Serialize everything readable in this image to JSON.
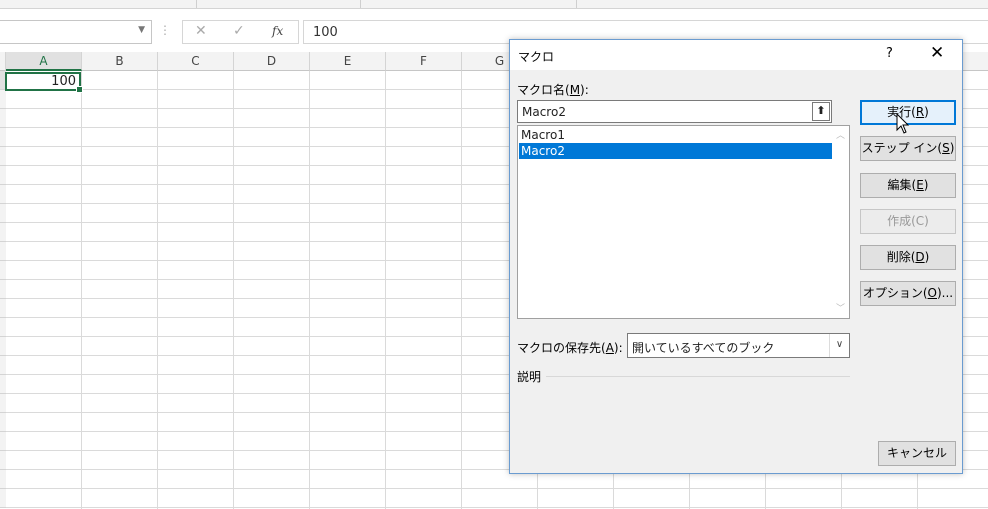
{
  "formula_bar": {
    "cancel_icon": "✕",
    "enter_icon": "✓",
    "function_icon": "fx",
    "value": "100"
  },
  "sheet": {
    "columns": [
      "A",
      "B",
      "C",
      "D",
      "E",
      "F",
      "G"
    ],
    "active_cell_value": "100"
  },
  "dialog": {
    "title": "マクロ",
    "help": "?",
    "close": "✕",
    "macro_name_label": "マクロ名(",
    "macro_name_key": "M",
    "macro_name_label_end": "):",
    "macro_name_value": "Macro2",
    "macro_list": [
      "Macro1",
      "Macro2"
    ],
    "selected_index": 1,
    "buttons": {
      "run": {
        "text": "実行(",
        "key": "R",
        "end": ")"
      },
      "step_in": {
        "text": "ステップ イン(",
        "key": "S",
        "end": ")"
      },
      "edit": {
        "text": "編集(",
        "key": "E",
        "end": ")"
      },
      "create": {
        "text": "作成(C)"
      },
      "delete": {
        "text": "削除(",
        "key": "D",
        "end": ")"
      },
      "options": {
        "text": "オプション(",
        "key": "O",
        "end": ")..."
      },
      "cancel": {
        "text": "キャンセル"
      }
    },
    "store_label": "マクロの保存先(",
    "store_key": "A",
    "store_label_end": "):",
    "store_value": "開いているすべてのブック",
    "description_label": "説明"
  },
  "colors": {
    "selection_blue": "#0078d7",
    "excel_green": "#217346",
    "dialog_border": "#6a9bd0"
  }
}
